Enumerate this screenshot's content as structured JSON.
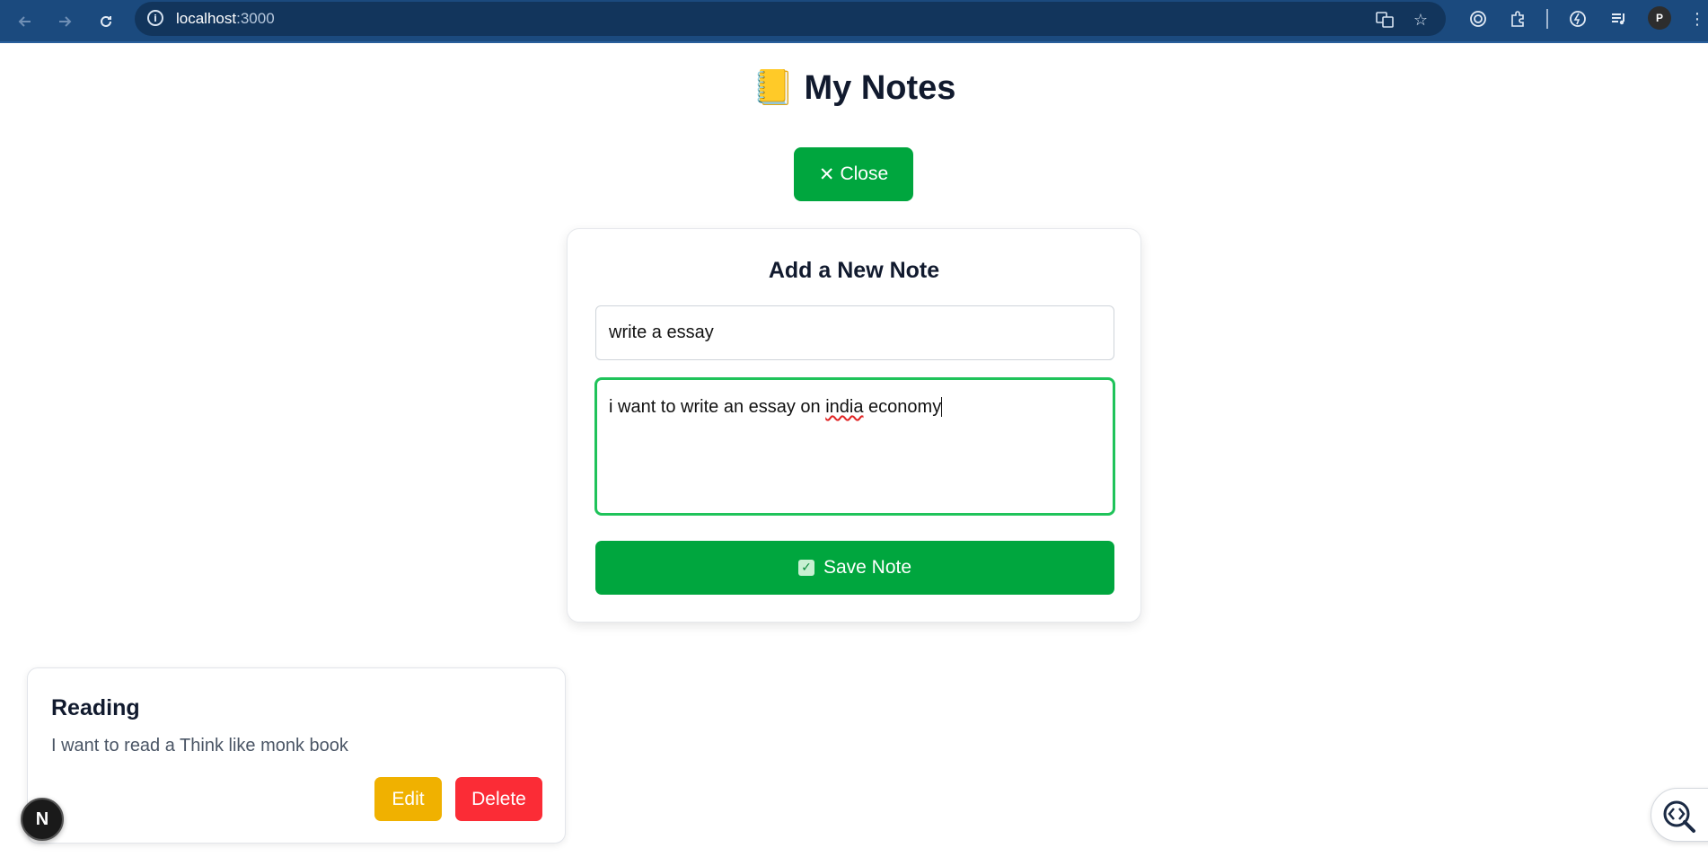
{
  "browser": {
    "url_host": "localhost",
    "url_port": ":3000",
    "back_icon": "arrow-left-icon",
    "forward_icon": "arrow-right-icon",
    "reload_icon": "reload-icon",
    "profile_initial": "P"
  },
  "page": {
    "title_emoji": "📒",
    "title": "My Notes",
    "close_button_icon": "✕",
    "close_button_label": "Close"
  },
  "form": {
    "heading": "Add a New Note",
    "title_value": "write a essay",
    "body_value_before": "i want to write an essay on ",
    "body_value_misspelled": "india",
    "body_value_after": " economy",
    "save_label": "Save Note",
    "colors": {
      "primary": "#00a63e",
      "focus": "#1fc35a"
    }
  },
  "notes": [
    {
      "title": "Reading",
      "body": "I want to read a Think like monk book",
      "edit_label": "Edit",
      "delete_label": "Delete"
    }
  ],
  "overlays": {
    "nextjs_badge": "N"
  }
}
